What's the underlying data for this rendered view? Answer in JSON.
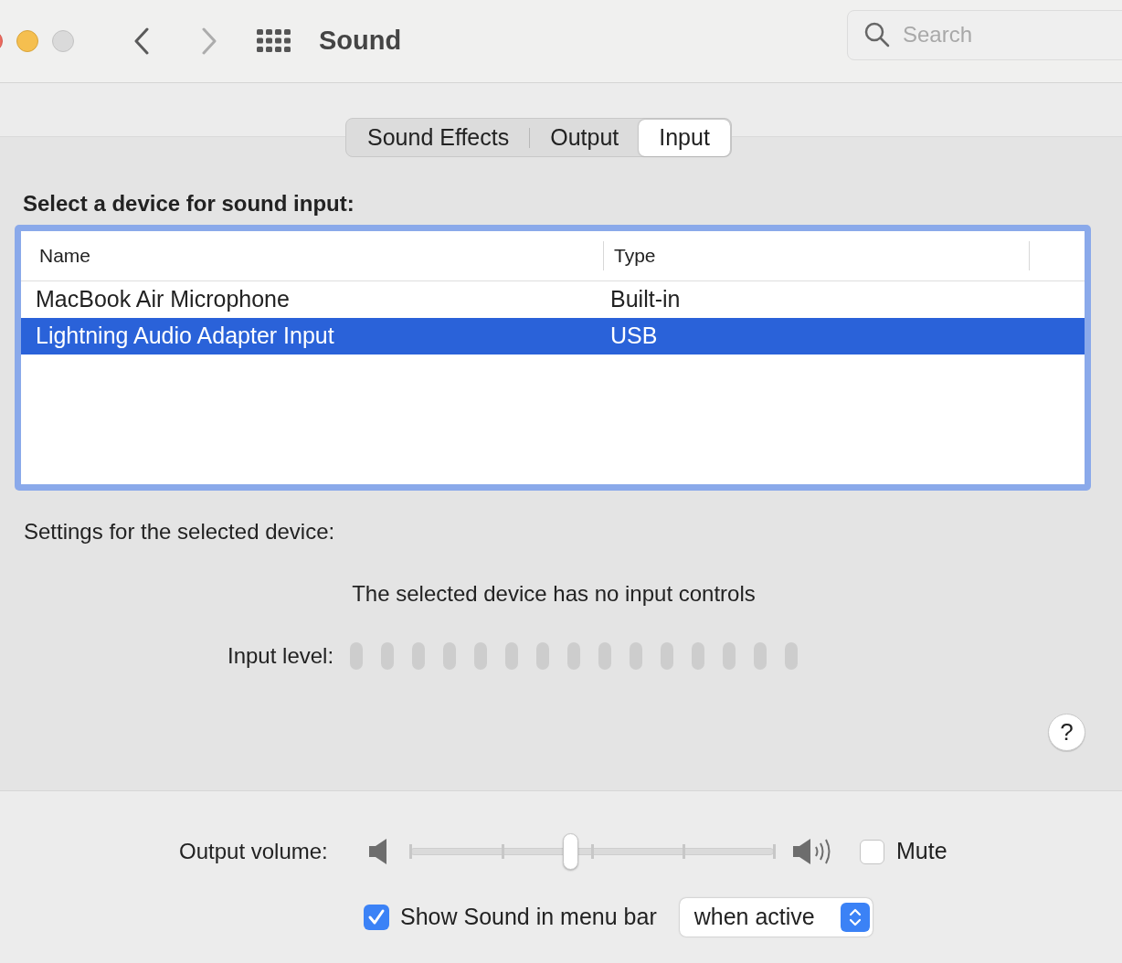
{
  "window": {
    "title": "Sound"
  },
  "search": {
    "placeholder": "Search"
  },
  "tabs": [
    {
      "label": "Sound Effects",
      "selected": false
    },
    {
      "label": "Output",
      "selected": false
    },
    {
      "label": "Input",
      "selected": true
    }
  ],
  "device_heading": "Select a device for sound input:",
  "table": {
    "columns": [
      "Name",
      "Type"
    ],
    "rows": [
      {
        "name": "MacBook Air Microphone",
        "type": "Built-in",
        "selected": false
      },
      {
        "name": "Lightning Audio Adapter Input",
        "type": "USB",
        "selected": true
      }
    ]
  },
  "settings_heading": "Settings for the selected device:",
  "no_controls_message": "The selected device has no input controls",
  "input_level": {
    "label": "Input level:"
  },
  "help_button": "?",
  "output_volume": {
    "label": "Output volume:",
    "level": 0.44
  },
  "mute": {
    "label": "Mute",
    "checked": false
  },
  "menu_bar": {
    "label": "Show Sound in menu bar",
    "checked": true,
    "popup_value": "when active"
  }
}
